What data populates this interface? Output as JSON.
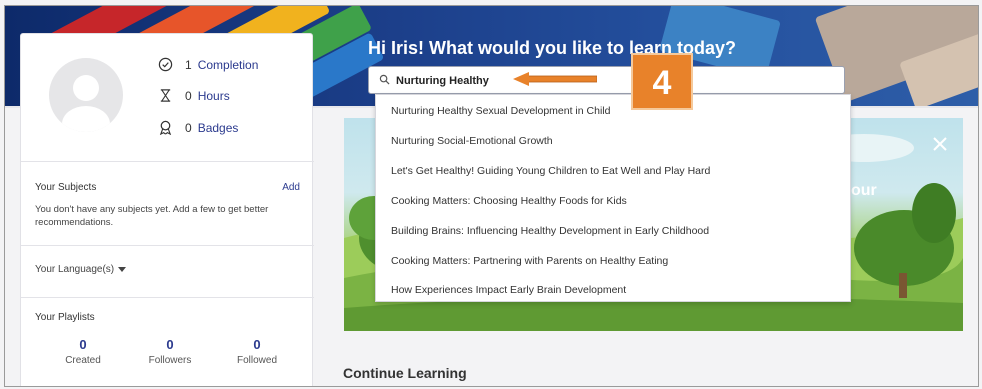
{
  "header": {
    "greeting": "Hi Iris! What would you like to learn today?"
  },
  "search": {
    "value": "Nurturing Healthy",
    "icon": "search-icon"
  },
  "callout": {
    "step_number": "4",
    "color": "#e8822a"
  },
  "profile": {
    "stats": [
      {
        "icon": "check-circle-icon",
        "value": "1",
        "label": "Completion"
      },
      {
        "icon": "hourglass-icon",
        "value": "0",
        "label": "Hours"
      },
      {
        "icon": "badge-icon",
        "value": "0",
        "label": "Badges"
      }
    ],
    "subjects": {
      "title": "Your Subjects",
      "add_label": "Add",
      "empty_text": "You don't have any subjects yet. Add a few to get better recommendations."
    },
    "languages": {
      "label": "Your Language(s)"
    },
    "playlists": {
      "title": "Your Playlists",
      "counts": [
        {
          "value": "0",
          "label": "Created"
        },
        {
          "value": "0",
          "label": "Followers"
        },
        {
          "value": "0",
          "label": "Followed"
        }
      ]
    }
  },
  "suggestions": [
    "Nurturing Healthy Sexual Development in Child",
    "Nurturing Social-Emotional Growth",
    "Let's Get Healthy! Guiding Young Children to Eat Well and Play Hard",
    "Cooking Matters: Choosing Healthy Foods for Kids",
    "Building Brains: Influencing Healthy Development in Early Childhood",
    "Cooking Matters: Partnering with Parents on Healthy Eating",
    "How Experiences Impact Early Brain Development"
  ],
  "hero": {
    "partial_text": "our"
  },
  "main": {
    "continue_learning": "Continue Learning"
  },
  "colors": {
    "brand_link": "#2b3a8e",
    "banner": "#1c3f8a"
  }
}
